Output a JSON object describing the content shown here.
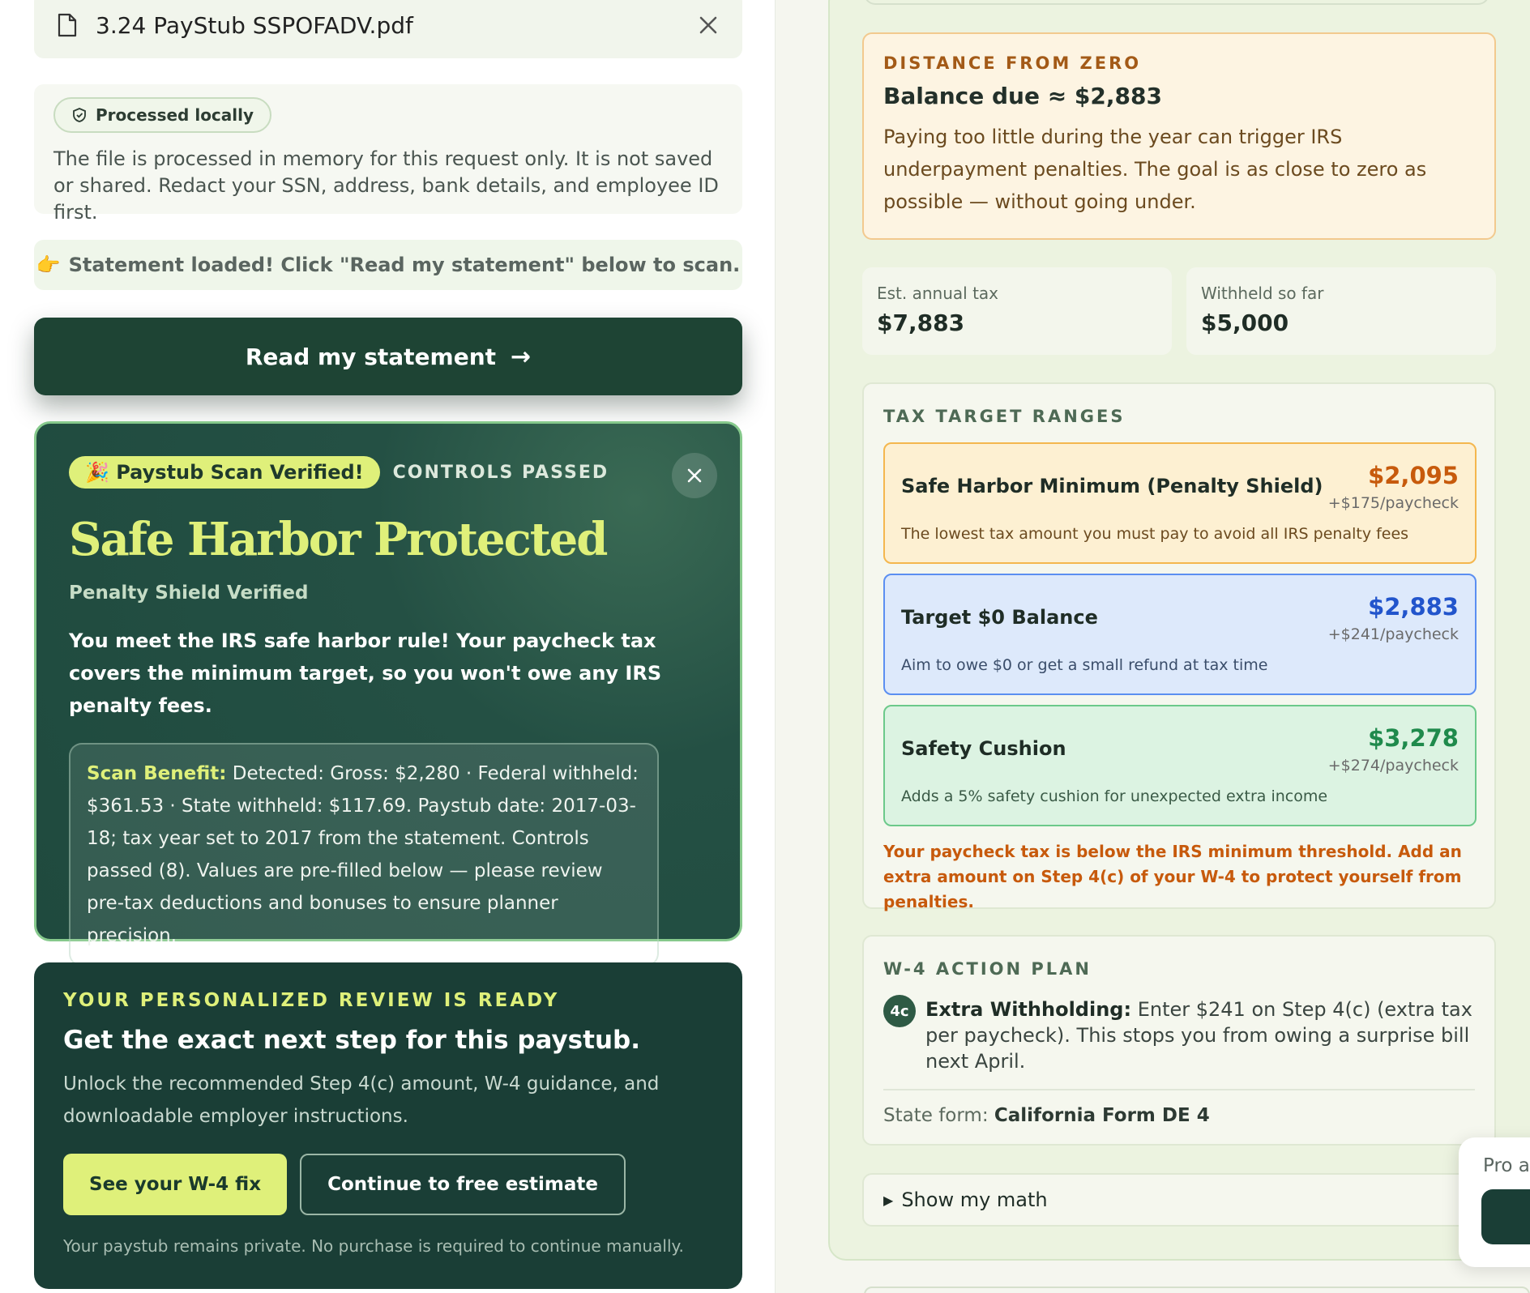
{
  "file": {
    "name": "3.24 PayStub SSPOFADV.pdf"
  },
  "privacy": {
    "pill": "Processed locally",
    "text": "The file is processed in memory for this request only. It is not saved or shared. Redact your SSN, address, bank details, and employee ID first."
  },
  "status": {
    "hand": "👉",
    "text": "Statement loaded! Click \"Read my statement\" below to scan."
  },
  "read_button": {
    "label": "Read my statement",
    "arrow": "→"
  },
  "verified": {
    "badge": "🎉 Paystub Scan Verified!",
    "controls": "CONTROLS PASSED",
    "title": "Safe Harbor Protected",
    "subtitle": "Penalty Shield Verified",
    "body": "You meet the IRS safe harbor rule! Your paycheck tax covers the minimum target, so you won't owe any IRS penalty fees.",
    "scan_label": "Scan Benefit:",
    "scan_text": " Detected: Gross: $2,280 · Federal withheld: $361.53 · State withheld: $117.69. Paystub date: 2017-03-18; tax year set to 2017 from the statement. Controls passed (8). Values are pre-filled below — please review pre-tax deductions and bonuses to ensure planner precision."
  },
  "review": {
    "eyebrow": "YOUR PERSONALIZED REVIEW IS READY",
    "title": "Get the exact next step for this paystub.",
    "body": "Unlock the recommended Step 4(c) amount, W-4 guidance, and downloadable employer instructions.",
    "primary": "See your W-4 fix",
    "secondary": "Continue to free estimate",
    "footer": "Your paystub remains private. No purchase is required to continue manually."
  },
  "distance": {
    "eyebrow": "DISTANCE FROM ZERO",
    "title": "Balance due ≈ $2,883",
    "body": "Paying too little during the year can trigger IRS underpayment penalties. The goal is as close to zero as possible — without going under."
  },
  "stats": [
    {
      "label": "Est. annual tax",
      "value": "$7,883"
    },
    {
      "label": "Withheld so far",
      "value": "$5,000"
    }
  ],
  "ranges": {
    "eyebrow": "TAX TARGET RANGES",
    "items": [
      {
        "name": "Safe Harbor Minimum (Penalty Shield)",
        "amount": "$2,095",
        "per": "+$175/paycheck",
        "desc": "The lowest tax amount you must pay to avoid all IRS penalty fees"
      },
      {
        "name": "Target $0 Balance",
        "amount": "$2,883",
        "per": "+$241/paycheck",
        "desc": "Aim to owe $0 or get a small refund at tax time"
      },
      {
        "name": "Safety Cushion",
        "amount": "$3,278",
        "per": "+$274/paycheck",
        "desc": "Adds a 5% safety cushion for unexpected extra income"
      }
    ],
    "warning": "Your paycheck tax is below the IRS minimum threshold. Add an extra amount on Step 4(c) of your W-4 to protect yourself from penalties."
  },
  "action_plan": {
    "eyebrow": "W-4 ACTION PLAN",
    "badge": "4c",
    "label": "Extra Withholding:",
    "text": " Enter $241 on Step 4(c) (extra tax per paycheck). This stops you from owing a surprise bill next April.",
    "state_label": "State form: ",
    "state_value": "California Form DE 4"
  },
  "math": {
    "tri": "▶",
    "label": "Show my math"
  },
  "popup": {
    "text": "Pro a"
  },
  "colors": {
    "dark_green": "#1e4434",
    "lime": "#dff07a",
    "orange": "#c75a0c",
    "blue": "#2255cc",
    "green": "#1f8a4c"
  }
}
